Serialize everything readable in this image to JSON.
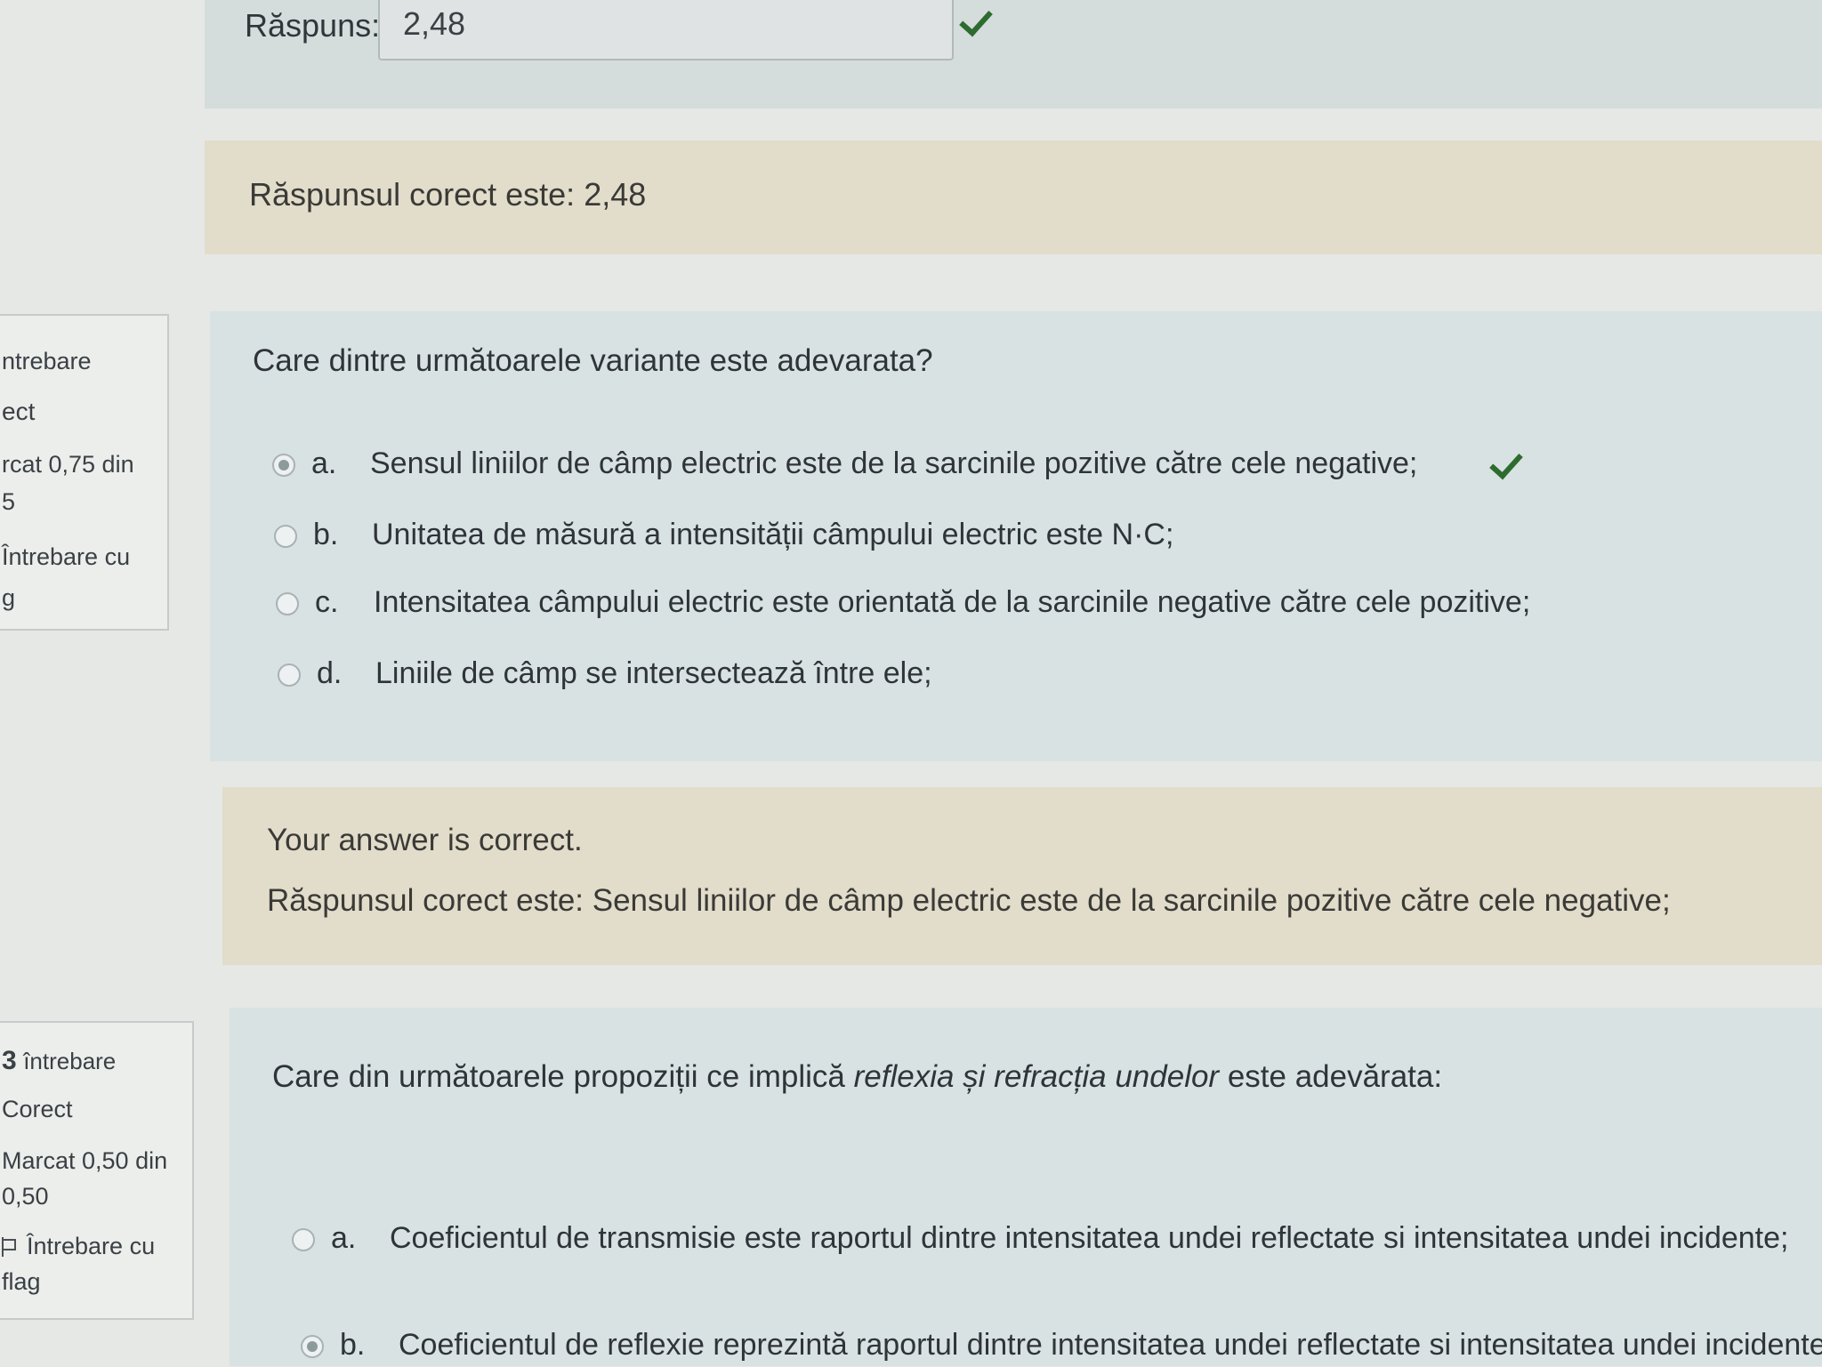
{
  "previous_question": {
    "answer_label": "Răspuns:",
    "answer_value": "2,48",
    "correct_answer_text": "Răspunsul corect este: 2,48"
  },
  "question2": {
    "info": {
      "number_label": "ntrebare",
      "state": "ect",
      "mark_line1": "rcat 0,75 din",
      "mark_line2": "5",
      "flag_line1": "Întrebare cu",
      "flag_line2": "g"
    },
    "text": "Care dintre următoarele variante este adevarata?",
    "options": [
      {
        "letter": "a.",
        "text": "Sensul liniilor de câmp electric este de la  sarcinile pozitive către cele negative;",
        "selected": true
      },
      {
        "letter": "b.",
        "text": "Unitatea de măsură a intensității câmpului electric este N·C;",
        "selected": false
      },
      {
        "letter": "c.",
        "text": "Intensitatea câmpului electric este orientată de la sarcinile negative către cele pozitive;",
        "selected": false
      },
      {
        "letter": "d.",
        "text": "Liniile de câmp se intersectează între ele;",
        "selected": false
      }
    ],
    "feedback_status": "Your answer is correct.",
    "feedback_correct": "Răspunsul corect este: Sensul liniilor de câmp electric este de la  sarcinile pozitive către cele negative;"
  },
  "question3": {
    "info": {
      "number": "3",
      "number_label": "întrebare",
      "state": "Corect",
      "mark_line1": "Marcat 0,50 din",
      "mark_line2": "0,50",
      "flag_line1": "Întrebare cu",
      "flag_line2": "flag"
    },
    "text_before": "Care din următoarele propoziții ce implică ",
    "text_emphasis": "reflexia și refracția undelor",
    "text_after": " este adevărata:",
    "options": [
      {
        "letter": "a.",
        "text": "Coeficientul de transmisie este raportul dintre intensitatea undei reflectate si intensitatea undei incidente;",
        "selected": false
      },
      {
        "letter": "b.",
        "text": "Coeficientul de reflexie reprezintă raportul dintre intensitatea undei reflectate si intensitatea undei incidente;",
        "selected": true
      }
    ]
  },
  "colors": {
    "page_bg": "#e6e8e6",
    "content_bg": "#d9e2e2",
    "feedback_bg": "#e2dccb",
    "check_green": "#2e6b2e"
  }
}
